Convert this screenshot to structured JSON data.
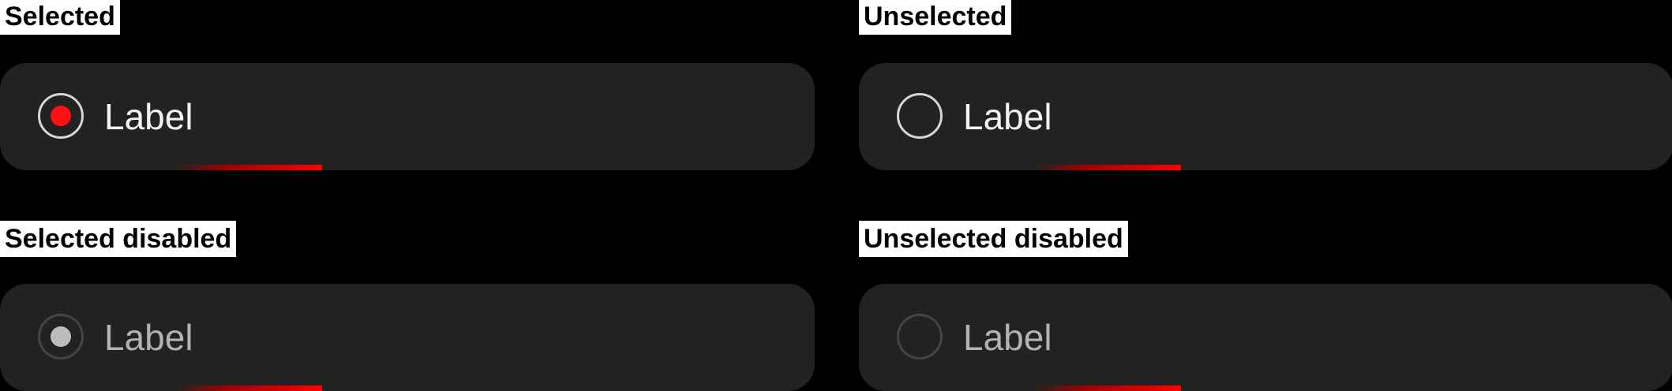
{
  "variants": [
    {
      "title": "Selected",
      "label": "Label",
      "selected": true,
      "disabled": false
    },
    {
      "title": "Unselected",
      "label": "Label",
      "selected": false,
      "disabled": false
    },
    {
      "title": "Selected disabled",
      "label": "Label",
      "selected": true,
      "disabled": true
    },
    {
      "title": "Unselected disabled",
      "label": "Label",
      "selected": false,
      "disabled": true
    }
  ],
  "colors": {
    "background": "#000000",
    "card": "#222222",
    "accent": "#ff1111",
    "disabled_dot": "#bdbdbd"
  }
}
